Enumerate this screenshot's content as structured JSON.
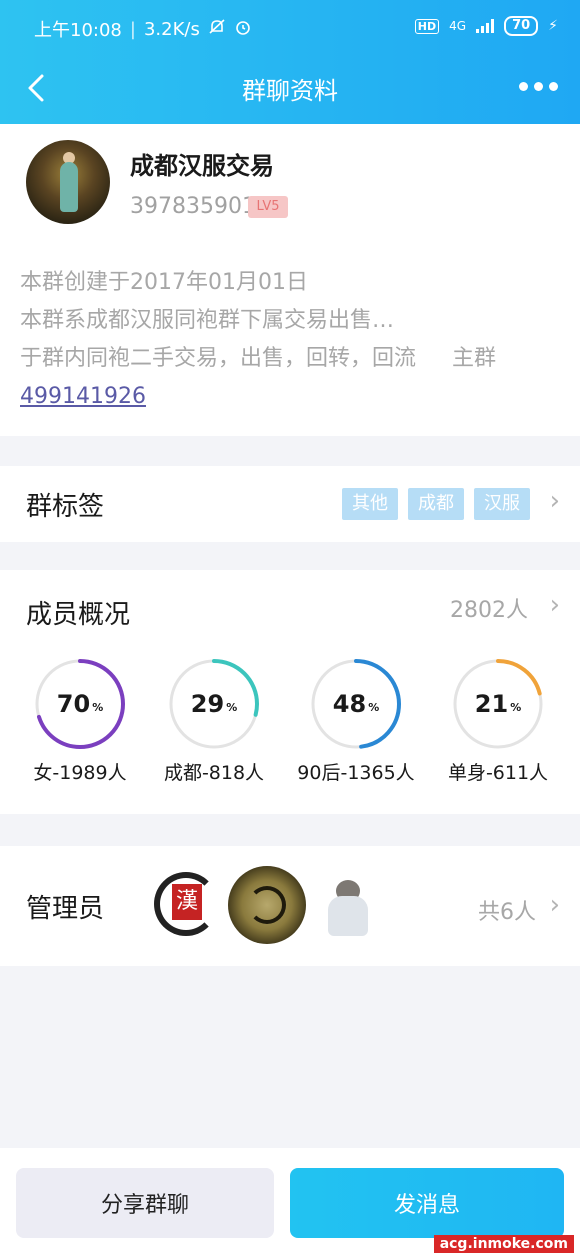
{
  "status_bar": {
    "time": "上午10:08",
    "speed": "3.2K/s",
    "hd": "HD",
    "network": "4G",
    "battery": "70"
  },
  "header": {
    "title": "群聊资料"
  },
  "group": {
    "name": "成都汉服交易",
    "id": "397835901",
    "level": "LV5",
    "description": {
      "line1": "本群创建于2017年01月01日",
      "line2": "本群系成都汉服同袍群下属交易出售…",
      "line3": "于群内同袍二手交易，出售，回转，回流",
      "main_group_label": "主群",
      "main_group_id": "499141926"
    }
  },
  "tags_section": {
    "title": "群标签",
    "tags": [
      "其他",
      "成都",
      "汉服"
    ]
  },
  "members_section": {
    "title": "成员概况",
    "count": "2802人",
    "stats": [
      {
        "percent": "70",
        "symbol": "%",
        "label": "女-1989人",
        "value": 0.7,
        "color": "#7b3fbf"
      },
      {
        "percent": "29",
        "symbol": "%",
        "label": "成都-818人",
        "value": 0.29,
        "color": "#3cc5bd"
      },
      {
        "percent": "48",
        "symbol": "%",
        "label": "90后-1365人",
        "value": 0.48,
        "color": "#2a88d4"
      },
      {
        "percent": "21",
        "symbol": "%",
        "label": "单身-611人",
        "value": 0.21,
        "color": "#f0a33a"
      }
    ]
  },
  "admins_section": {
    "title": "管理员",
    "count": "共6人",
    "avatar_seal_char": "漢"
  },
  "actions": {
    "share_label": "分享群聊",
    "send_label": "发消息"
  },
  "watermark": "acg.inmoke.com",
  "colors": {
    "header_start": "#2ec3f1",
    "header_end": "#1fa8f3",
    "tag_bg": "#b6ddf6",
    "link": "#5a5aa6"
  }
}
